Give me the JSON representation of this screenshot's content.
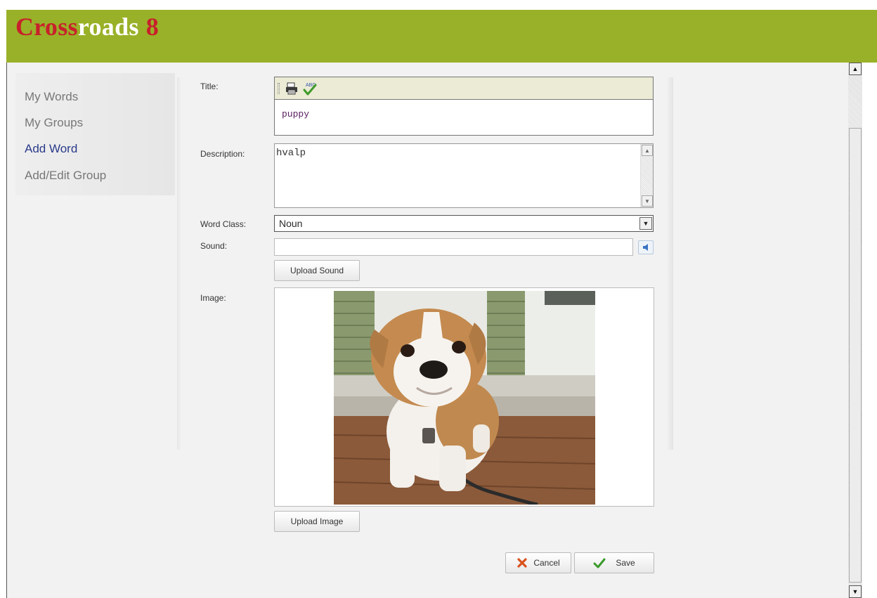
{
  "app": {
    "logo_part1": "Cross",
    "logo_part2": "roads",
    "logo_part3": "8"
  },
  "sidebar": {
    "items": [
      {
        "label": "My Words",
        "active": false
      },
      {
        "label": "My Groups",
        "active": false
      },
      {
        "label": "Add Word",
        "active": true
      },
      {
        "label": "Add/Edit Group",
        "active": false
      }
    ]
  },
  "form": {
    "title_label": "Title:",
    "title_value": "puppy",
    "toolbar_icons": [
      "print-icon",
      "spellcheck-icon"
    ],
    "description_label": "Description:",
    "description_value": "hvalp",
    "word_class_label": "Word Class:",
    "word_class_value": "Noun",
    "sound_label": "Sound:",
    "sound_value": "",
    "upload_sound_label": "Upload Sound",
    "image_label": "Image:",
    "upload_image_label": "Upload Image",
    "cancel_label": "Cancel",
    "save_label": "Save"
  },
  "colors": {
    "header": "#99b128",
    "logo_red": "#c8202b",
    "active_link": "#2b3b8a"
  }
}
